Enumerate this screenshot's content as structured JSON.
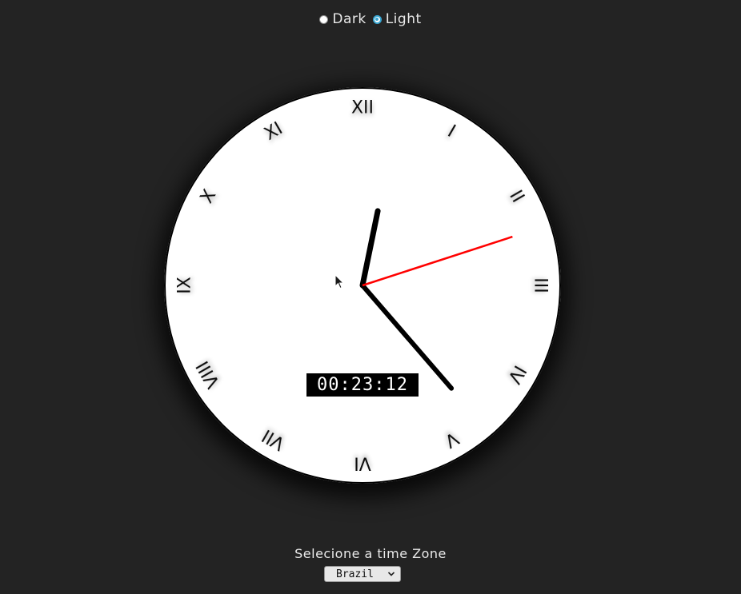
{
  "theme": {
    "options": [
      {
        "label": "Dark",
        "checked": false
      },
      {
        "label": "Light",
        "checked": true
      }
    ]
  },
  "clock": {
    "numerals": [
      "XII",
      "I",
      "II",
      "III",
      "IV",
      "V",
      "VI",
      "VII",
      "VIII",
      "IX",
      "X",
      "XI"
    ],
    "digital_time": "00:23:12",
    "hands": {
      "hour_deg": 11.6,
      "minute_deg": 139.2,
      "second_deg": 72
    },
    "second_hand_color": "#ff0000"
  },
  "timezone": {
    "label": "Selecione a time Zone",
    "selected": "Brazil"
  }
}
